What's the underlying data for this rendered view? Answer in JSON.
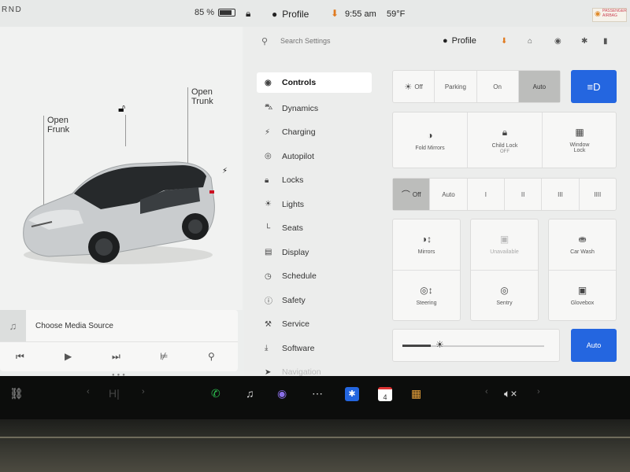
{
  "status_bar": {
    "gear_letters": "RND",
    "battery_percent": "85 %",
    "battery_level": 0.85,
    "profile_label": "Profile",
    "time": "9:55 am",
    "temperature": "59°F",
    "airbag_text": "PASSENGER AIRBAG"
  },
  "car_view": {
    "frunk_label": "Open\nFrunk",
    "trunk_label": "Open\nTrunk",
    "lock_icon": "unlocked-icon",
    "charge_icon": "bolt-icon"
  },
  "media": {
    "source_label": "Choose Media Source",
    "controls": [
      "previous-icon",
      "play-icon",
      "next-icon",
      "equalizer-icon",
      "search-icon"
    ]
  },
  "settings": {
    "search_placeholder": "Search Settings",
    "profile_label": "Profile",
    "nav": [
      {
        "label": "Controls",
        "icon": "toggle-icon"
      },
      {
        "label": "Dynamics",
        "icon": "car-icon"
      },
      {
        "label": "Charging",
        "icon": "bolt-icon"
      },
      {
        "label": "Autopilot",
        "icon": "steering-wheel-icon"
      },
      {
        "label": "Locks",
        "icon": "lock-icon"
      },
      {
        "label": "Lights",
        "icon": "sun-icon"
      },
      {
        "label": "Seats",
        "icon": "seat-icon"
      },
      {
        "label": "Display",
        "icon": "display-icon"
      },
      {
        "label": "Schedule",
        "icon": "clock-icon"
      },
      {
        "label": "Safety",
        "icon": "info-icon"
      },
      {
        "label": "Service",
        "icon": "wrench-icon"
      },
      {
        "label": "Software",
        "icon": "download-icon"
      },
      {
        "label": "Navigation",
        "icon": "navigation-icon"
      }
    ],
    "active_nav": "Controls",
    "lights": {
      "options": [
        "Off",
        "Parking",
        "On",
        "Auto"
      ],
      "selected": "Auto"
    },
    "quick_row": [
      {
        "label": "Fold Mirrors",
        "sub": ""
      },
      {
        "label": "Child Lock",
        "sub": "OFF"
      },
      {
        "label": "Window\nLock",
        "sub": ""
      }
    ],
    "wipers": {
      "options": [
        "Off",
        "Auto",
        "I",
        "II",
        "III",
        "IIII"
      ],
      "selected": "Off"
    },
    "grid": [
      {
        "label": "Mirrors",
        "enabled": true
      },
      {
        "label": "Unavailable",
        "enabled": false
      },
      {
        "label": "Car Wash",
        "enabled": true
      },
      {
        "label": "Steering",
        "enabled": true
      },
      {
        "label": "Sentry",
        "enabled": true
      },
      {
        "label": "Glovebox",
        "enabled": true
      }
    ],
    "brightness_auto_label": "Auto",
    "brightness_level": 0.2
  },
  "taskbar": {
    "music_label": "",
    "calendar_day": "4",
    "volume_icon": "mute-icon"
  },
  "colors": {
    "accent_blue": "#2466e0",
    "phone_green": "#2dbe4f",
    "download_orange": "#e07a1f"
  }
}
